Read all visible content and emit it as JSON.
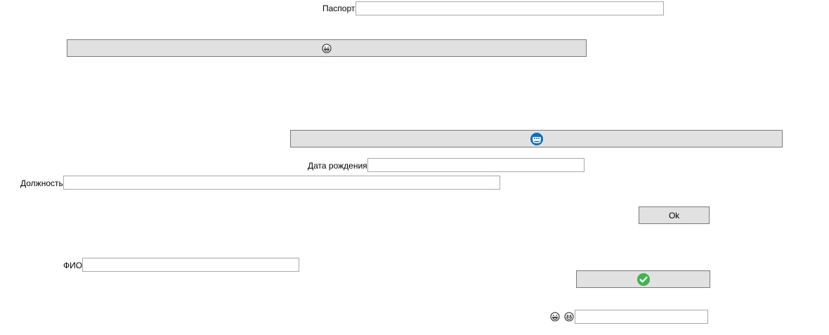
{
  "form": {
    "passport_label": "Паспорт",
    "passport_value": "",
    "birthdate_label": "Дата рождения",
    "birthdate_value": "",
    "position_label": "Должность",
    "position_value": "",
    "fio_label": "ФИО",
    "fio_value": "",
    "extra_value": ""
  },
  "buttons": {
    "ok_label": "Ok",
    "emoji_button_icon": "grinning-face-with-sweat-icon",
    "wallet_button_icon": "blue-wallet-icon",
    "check_button_icon": "green-checkmark-icon"
  },
  "icons": {
    "extra_icon_1": "grinning-face-with-sweat-icon",
    "extra_icon_2": "grinning-squinting-face-icon"
  },
  "colors": {
    "button_bg": "#e1e1e1",
    "border": "#a9a9a9",
    "accent_blue": "#0a6fc2",
    "accent_green": "#3fb34f"
  }
}
